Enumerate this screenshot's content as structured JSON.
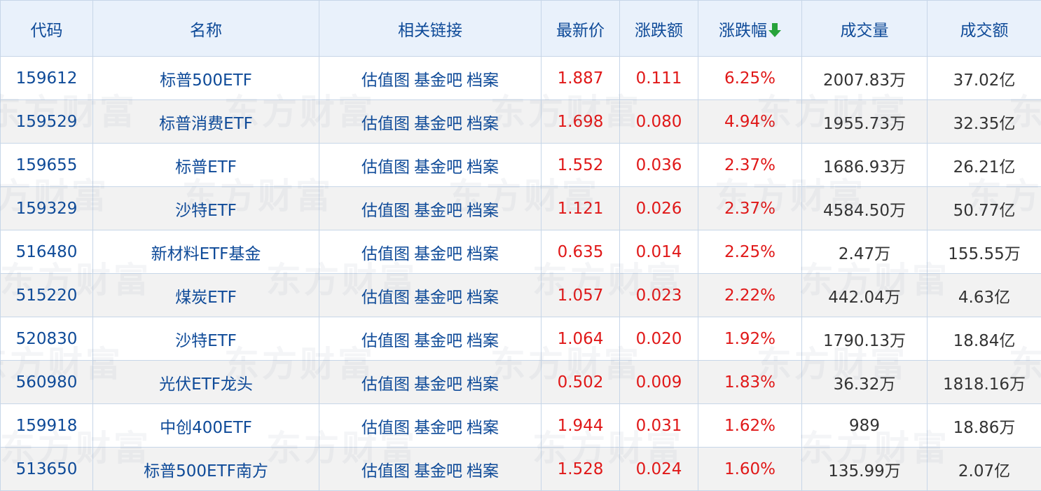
{
  "table": {
    "headers": {
      "code": "代码",
      "name": "名称",
      "links": "相关链接",
      "price": "最新价",
      "change": "涨跌额",
      "pct": "涨跌幅",
      "volume": "成交量",
      "amount": "成交额"
    },
    "sort_icon": "down-arrow-icon",
    "link_labels": [
      "估值图",
      "基金吧",
      "档案"
    ],
    "rows": [
      {
        "code": "159612",
        "name": "标普500ETF",
        "price": "1.887",
        "change": "0.111",
        "pct": "6.25%",
        "volume": "2007.83万",
        "amount": "37.02亿"
      },
      {
        "code": "159529",
        "name": "标普消费ETF",
        "price": "1.698",
        "change": "0.080",
        "pct": "4.94%",
        "volume": "1955.73万",
        "amount": "32.35亿"
      },
      {
        "code": "159655",
        "name": "标普ETF",
        "price": "1.552",
        "change": "0.036",
        "pct": "2.37%",
        "volume": "1686.93万",
        "amount": "26.21亿"
      },
      {
        "code": "159329",
        "name": "沙特ETF",
        "price": "1.121",
        "change": "0.026",
        "pct": "2.37%",
        "volume": "4584.50万",
        "amount": "50.77亿"
      },
      {
        "code": "516480",
        "name": "新材料ETF基金",
        "price": "0.635",
        "change": "0.014",
        "pct": "2.25%",
        "volume": "2.47万",
        "amount": "155.55万"
      },
      {
        "code": "515220",
        "name": "煤炭ETF",
        "price": "1.057",
        "change": "0.023",
        "pct": "2.22%",
        "volume": "442.04万",
        "amount": "4.63亿"
      },
      {
        "code": "520830",
        "name": "沙特ETF",
        "price": "1.064",
        "change": "0.020",
        "pct": "1.92%",
        "volume": "1790.13万",
        "amount": "18.84亿"
      },
      {
        "code": "560980",
        "name": "光伏ETF龙头",
        "price": "0.502",
        "change": "0.009",
        "pct": "1.83%",
        "volume": "36.32万",
        "amount": "1818.16万"
      },
      {
        "code": "159918",
        "name": "中创400ETF",
        "price": "1.944",
        "change": "0.031",
        "pct": "1.62%",
        "volume": "989",
        "amount": "18.86万"
      },
      {
        "code": "513650",
        "name": "标普500ETF南方",
        "price": "1.528",
        "change": "0.024",
        "pct": "1.60%",
        "volume": "135.99万",
        "amount": "2.07亿"
      }
    ]
  },
  "watermark": "东方财富",
  "colors": {
    "header_bg": "#e9f1fb",
    "link": "#0e4a98",
    "up": "#e01818",
    "sort_arrow": "#27a33a",
    "border": "#c7d6e8"
  }
}
